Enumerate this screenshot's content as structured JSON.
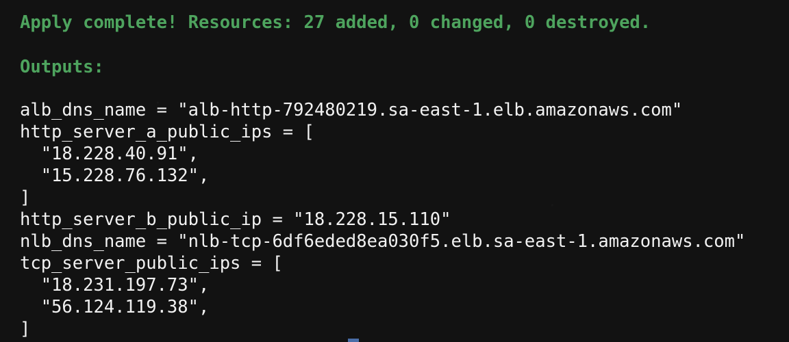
{
  "apply_message": "Apply complete! Resources: 27 added, 0 changed, 0 destroyed.",
  "outputs_header": "Outputs:",
  "output_lines": [
    "alb_dns_name = \"alb-http-792480219.sa-east-1.elb.amazonaws.com\"",
    "http_server_a_public_ips = [",
    "  \"18.228.40.91\",",
    "  \"15.228.76.132\",",
    "]",
    "http_server_b_public_ip = \"18.228.15.110\"",
    "nlb_dns_name = \"nlb-tcp-6df6eded8ea030f5.elb.sa-east-1.amazonaws.com\"",
    "tcp_server_public_ips = [",
    "  \"18.231.197.73\",",
    "  \"56.124.119.38\",",
    "]"
  ],
  "colors": {
    "background": "#121212",
    "success_text": "#4ea45e",
    "output_text": "#f1f1f1"
  }
}
